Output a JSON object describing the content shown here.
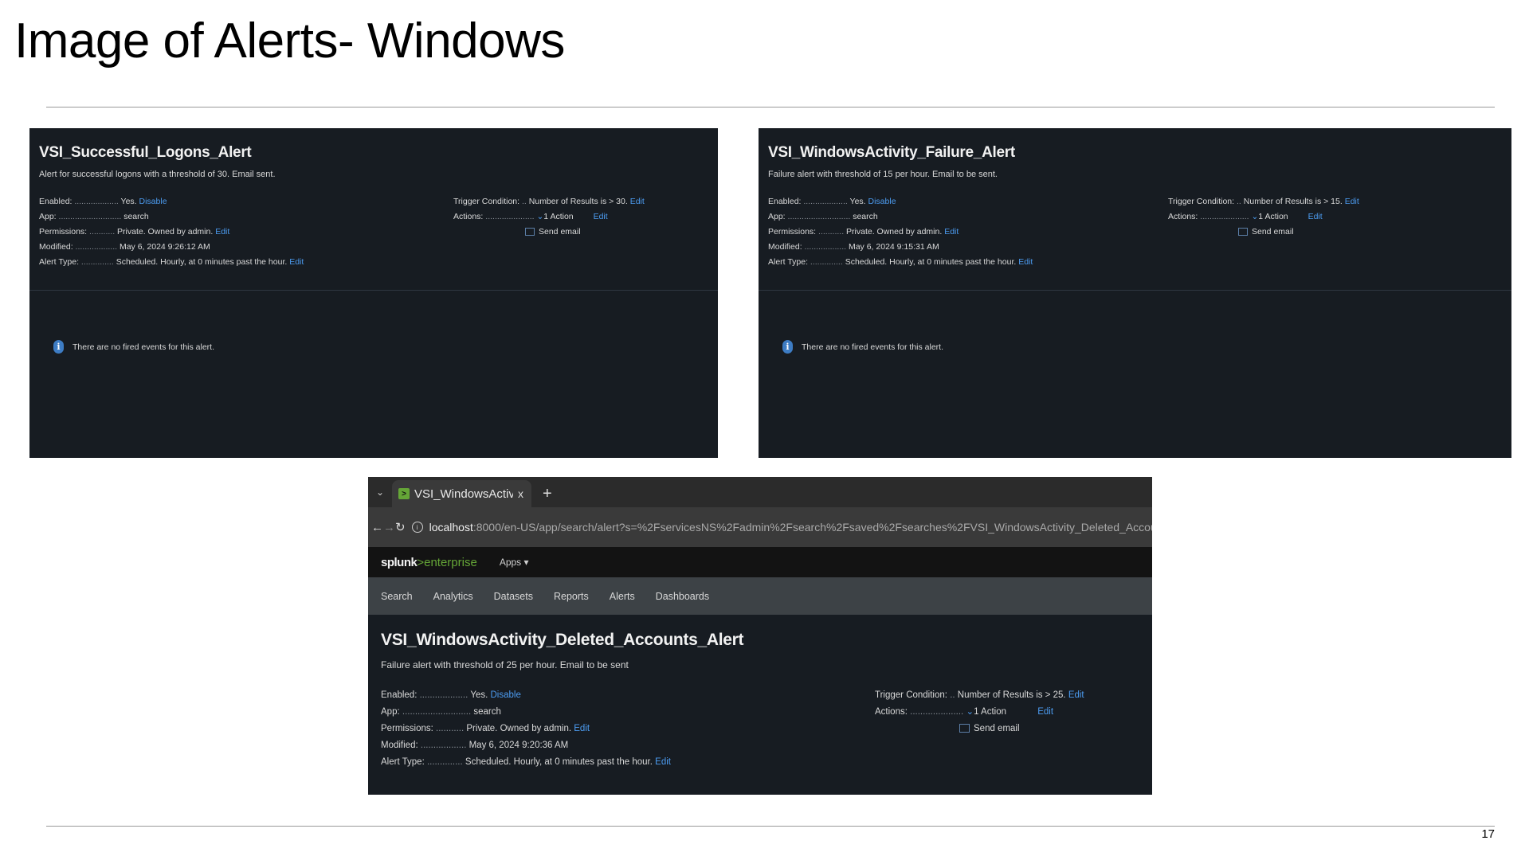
{
  "slide": {
    "title": "Image of Alerts- Windows",
    "page_number": "17"
  },
  "shot1": {
    "title": "VSI_Successful_Logons_Alert",
    "description": "Alert for successful logons with a threshold of 30. Email sent.",
    "left": [
      {
        "key": "Enabled:",
        "dots": "...................",
        "value": "Yes.",
        "link": "Disable"
      },
      {
        "key": "App:",
        "dots": "...........................",
        "value": "search",
        "link": ""
      },
      {
        "key": "Permissions:",
        "dots": "...........",
        "value": "Private. Owned by admin.",
        "link": "Edit"
      },
      {
        "key": "Modified:",
        "dots": "..................",
        "value": "May 6, 2024 9:26:12 AM",
        "link": ""
      },
      {
        "key": "Alert Type:",
        "dots": "..............",
        "value": "Scheduled. Hourly, at 0 minutes past the hour.",
        "link": "Edit"
      }
    ],
    "trigger": {
      "key": "Trigger Condition:",
      "dots": "..",
      "value": "Number of Results is > 30.",
      "link": "Edit"
    },
    "actions": {
      "key": "Actions:",
      "dots": ".....................",
      "value": "1 Action",
      "link": "Edit",
      "email": "Send email"
    },
    "message": "There are no fired events for this alert."
  },
  "shot2": {
    "title": "VSI_WindowsActivity_Failure_Alert",
    "description": "Failure alert with threshold of 15 per hour. Email to be sent.",
    "left": [
      {
        "key": "Enabled:",
        "dots": "...................",
        "value": "Yes.",
        "link": "Disable"
      },
      {
        "key": "App:",
        "dots": "...........................",
        "value": "search",
        "link": ""
      },
      {
        "key": "Permissions:",
        "dots": "...........",
        "value": "Private. Owned by admin.",
        "link": "Edit"
      },
      {
        "key": "Modified:",
        "dots": "..................",
        "value": "May 6, 2024 9:15:31 AM",
        "link": ""
      },
      {
        "key": "Alert Type:",
        "dots": "..............",
        "value": "Scheduled. Hourly, at 0 minutes past the hour.",
        "link": "Edit"
      }
    ],
    "trigger": {
      "key": "Trigger Condition:",
      "dots": "..",
      "value": "Number of Results is > 15.",
      "link": "Edit"
    },
    "actions": {
      "key": "Actions:",
      "dots": ".....................",
      "value": "1 Action",
      "link": "Edit",
      "email": "Send email"
    },
    "message": "There are no fired events for this alert."
  },
  "shot3": {
    "browser": {
      "tab_label": "VSI_WindowsActivity",
      "tab_close": "x",
      "new_tab": "+",
      "url_host": "localhost",
      "url_path": ":8000/en-US/app/search/alert?s=%2FservicesNS%2Fadmin%2Fsearch%2Fsaved%2Fsearches%2FVSI_WindowsActivity_Deleted_Accounts_Alert"
    },
    "splunk": {
      "logo_main": "splunk",
      "logo_sub": ">enterprise",
      "apps_menu": "Apps ▾"
    },
    "nav": [
      "Search",
      "Analytics",
      "Datasets",
      "Reports",
      "Alerts",
      "Dashboards"
    ],
    "title": "VSI_WindowsActivity_Deleted_Accounts_Alert",
    "description": "Failure alert with threshold of 25 per hour. Email to be sent",
    "left": [
      {
        "key": "Enabled:",
        "dots": "...................",
        "value": "Yes.",
        "link": "Disable"
      },
      {
        "key": "App:",
        "dots": "...........................",
        "value": "search",
        "link": ""
      },
      {
        "key": "Permissions:",
        "dots": "...........",
        "value": "Private. Owned by admin.",
        "link": "Edit"
      },
      {
        "key": "Modified:",
        "dots": "..................",
        "value": "May 6, 2024 9:20:36 AM",
        "link": ""
      },
      {
        "key": "Alert Type:",
        "dots": "..............",
        "value": "Scheduled. Hourly, at 0 minutes past the hour.",
        "link": "Edit"
      }
    ],
    "trigger": {
      "key": "Trigger Condition:",
      "dots": "..",
      "value": "Number of Results is > 25.",
      "link": "Edit"
    },
    "actions": {
      "key": "Actions:",
      "dots": ".....................",
      "value": "1 Action",
      "link": "Edit",
      "email": "Send email"
    }
  },
  "colors": {
    "panel_bg": "#171c22",
    "link": "#4c9cf1",
    "splunk_green": "#65a637"
  }
}
